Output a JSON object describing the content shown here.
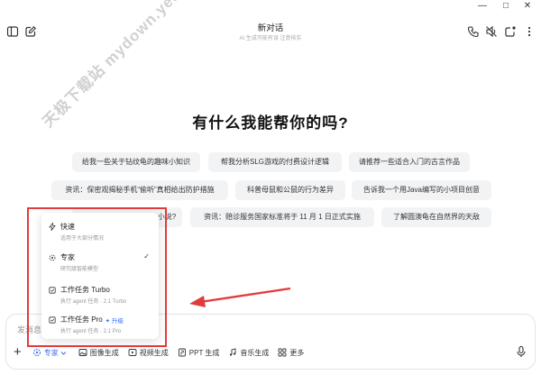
{
  "window": {
    "minimize": "—",
    "maximize": "□",
    "close": "✕"
  },
  "header": {
    "title": "新对话",
    "subtitle": "AI 生成可能有误 注意核实"
  },
  "watermark": "天极下载站 mydown.yesky.com",
  "main_question": "有什么我能帮你的吗?",
  "suggestions": {
    "row1": [
      "给我一些关于钻纹龟的趣味小知识",
      "帮我分析SLG游戏的付费设计逻辑",
      "请推荐一些适合入门的古言作品"
    ],
    "row2": [
      "资讯：保密观揭秘手机“偷听”真相给出防护措施",
      "科普母鼠和公鼠的行为差异",
      "告诉我一个用Java编写的小项目创意"
    ],
    "row3": [
      "写一篇以猫咪视角出发的小说?",
      "资讯：赔诊服务国家标准将于 11 月 1 日正式实施",
      "了解圆澳龟在自然界的天敌"
    ]
  },
  "popup": {
    "options": [
      {
        "title": "快速",
        "desc": "适用于大部分情况"
      },
      {
        "title": "专家",
        "desc": "研究级智能模型",
        "selected": true
      },
      {
        "title": "工作任务 Turbo",
        "desc": "执行 agent 任务 · 2.1 Turbo"
      },
      {
        "title": "工作任务 Pro",
        "desc": "执行 agent 任务 · 2.1 Pro",
        "badge": "✦ 升级"
      }
    ]
  },
  "input": {
    "placeholder": "发消息",
    "toolbar": {
      "plus": "+",
      "expert": "专家",
      "image": "图像生成",
      "video": "视频生成",
      "ppt": "PPT 生成",
      "music": "音乐生成",
      "more": "更多"
    }
  },
  "colors": {
    "accent": "#3b6fe8",
    "annotation": "#e23b3b",
    "chip_bg": "#f2f3f5"
  }
}
